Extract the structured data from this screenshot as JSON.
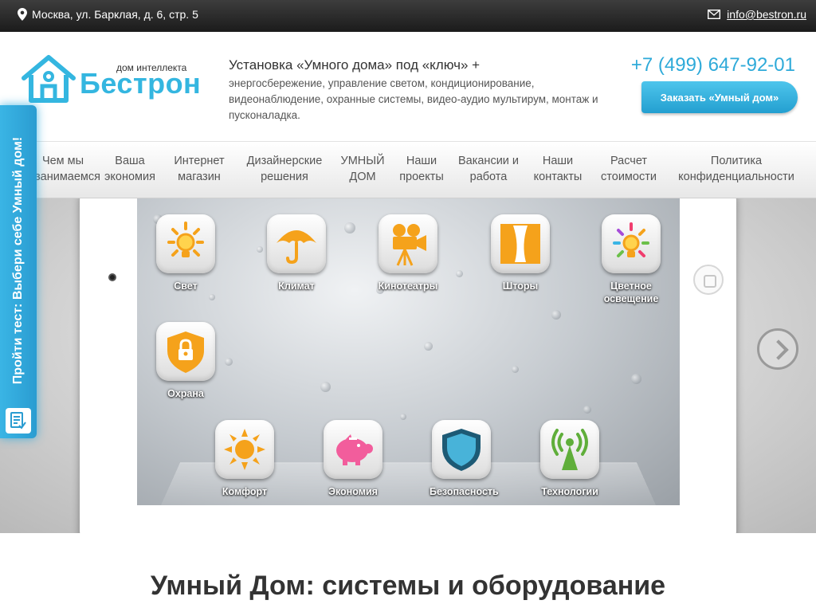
{
  "topbar": {
    "address": "Москва, ул. Барклая, д. 6, стр. 5",
    "email": "info@bestron.ru"
  },
  "logo": {
    "tagline": "дом интеллекта",
    "name": "Бестрон"
  },
  "header": {
    "title": "Установка «Умного дома» под «ключ» +",
    "subtitle": "энергосбережение, управление светом, кондиционирование, видеонаблюдение, охранные системы, видео-аудио мультирум, монтаж и пусконаладка.",
    "phone": "+7 (499) 647-92-01",
    "order_button": "Заказать «Умный дом»"
  },
  "nav": [
    "Чем мы занимаемся",
    "Ваша экономия",
    "Интернет магазин",
    "Дизайнерские решения",
    "УМНЫЙ ДОМ",
    "Наши проекты",
    "Вакансии и работа",
    "Наши контакты",
    "Расчет стоимости",
    "Политика конфиденциальности"
  ],
  "apps": [
    {
      "label": "Свет",
      "icon": "light-bulb-icon"
    },
    {
      "label": "Климат",
      "icon": "umbrella-icon"
    },
    {
      "label": "Кинотеатры",
      "icon": "movie-camera-icon"
    },
    {
      "label": "Шторы",
      "icon": "curtains-icon"
    },
    {
      "label": "Цветное освещение",
      "icon": "color-bulb-icon"
    },
    {
      "label": "Охрана",
      "icon": "lock-shield-icon"
    }
  ],
  "dock": [
    {
      "label": "Комфорт",
      "icon": "sun-icon"
    },
    {
      "label": "Экономия",
      "icon": "piggy-bank-icon"
    },
    {
      "label": "Безопасность",
      "icon": "shield-icon"
    },
    {
      "label": "Технологии",
      "icon": "antenna-icon"
    }
  ],
  "side_tab": {
    "label": "Пройти тест: Выбери себе Умный дом!"
  },
  "page_title": "Умный Дом: системы и оборудование",
  "colors": {
    "accent": "#2eaad9",
    "orange": "#f5a21b",
    "topbar": "#2a2a2a"
  }
}
